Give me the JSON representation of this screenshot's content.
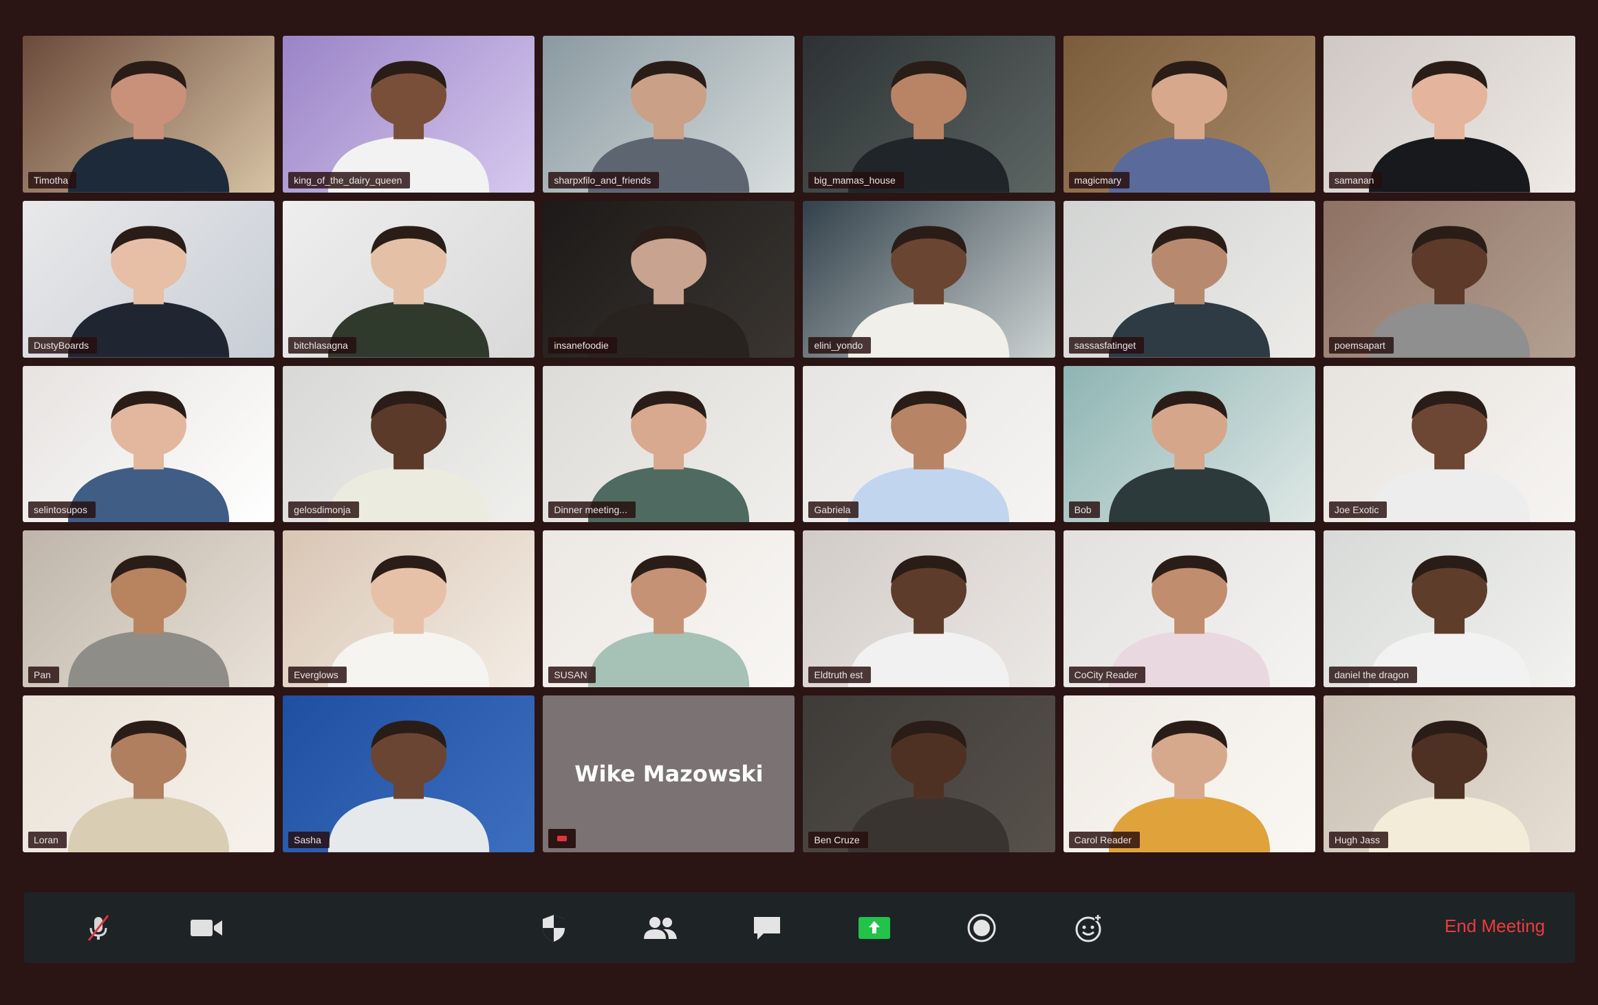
{
  "participants": [
    {
      "name": "Timotha",
      "skin": "#c9907a",
      "bg1": "#6b4a3a",
      "bg2": "#d7c3a5",
      "shirt": "#1d2a3a"
    },
    {
      "name": "king_of_the_dairy_queen",
      "skin": "#7a4f3a",
      "bg1": "#9b84c7",
      "bg2": "#d6c9ef",
      "shirt": "#f2f2f2"
    },
    {
      "name": "sharpxfilo_and_friends",
      "skin": "#caa086",
      "bg1": "#8a9aa1",
      "bg2": "#d9dede",
      "shirt": "#5c6570"
    },
    {
      "name": "big_mamas_house",
      "skin": "#b98466",
      "bg1": "#2c3233",
      "bg2": "#5e6664",
      "shirt": "#1f2528"
    },
    {
      "name": "magicmary",
      "skin": "#d8a88d",
      "bg1": "#7b5c3b",
      "bg2": "#a88b6b",
      "shirt": "#5a6a9a"
    },
    {
      "name": "samanan",
      "skin": "#e4b49c",
      "bg1": "#cfc8c4",
      "bg2": "#efeae6",
      "shirt": "#17191c"
    },
    {
      "name": "DustyBoards",
      "skin": "#e6bfa6",
      "bg1": "#e9e9ea",
      "bg2": "#c8ced6",
      "shirt": "#1f2632"
    },
    {
      "name": "bitchlasagna",
      "skin": "#e4c0a6",
      "bg1": "#eeeeee",
      "bg2": "#d9d9d9",
      "shirt": "#2f3a2c"
    },
    {
      "name": "insanefoodie",
      "skin": "#c7a390",
      "bg1": "#1c1a18",
      "bg2": "#3a3531",
      "shirt": "#28231f"
    },
    {
      "name": "elini_yondo",
      "skin": "#6a4532",
      "bg1": "#32414a",
      "bg2": "#cdd3d3",
      "shirt": "#f1efe9"
    },
    {
      "name": "sassasfatinget",
      "skin": "#b78a70",
      "bg1": "#d2d4d3",
      "bg2": "#ecebe8",
      "shirt": "#2e3a44"
    },
    {
      "name": "poemsapart",
      "skin": "#5d3a2a",
      "bg1": "#8e7264",
      "bg2": "#b4a091",
      "shirt": "#8f8f8f"
    },
    {
      "name": "selintosupos",
      "skin": "#e3b79e",
      "bg1": "#e6e3e0",
      "bg2": "#ffffff",
      "shirt": "#3f5d85"
    },
    {
      "name": "gelosdimonja",
      "skin": "#5b3a2a",
      "bg1": "#d8d9d6",
      "bg2": "#efefec",
      "shirt": "#ecebdf"
    },
    {
      "name": "Dinner meeting...",
      "skin": "#d8a98e",
      "bg1": "#dedcd8",
      "bg2": "#efeeeb",
      "shirt": "#4f6a60"
    },
    {
      "name": "Gabriela",
      "skin": "#b88466",
      "bg1": "#e7e5e3",
      "bg2": "#f5f4f3",
      "shirt": "#c2d5ef"
    },
    {
      "name": "Bob",
      "skin": "#d6a68a",
      "bg1": "#8db5b3",
      "bg2": "#dfe8e6",
      "shirt": "#2d3a3c"
    },
    {
      "name": "Joe Exotic",
      "skin": "#6e4634",
      "bg1": "#e7e3de",
      "bg2": "#f6f4f1",
      "shirt": "#ededed"
    },
    {
      "name": "Pan",
      "skin": "#b8835f",
      "bg1": "#bfb5aa",
      "bg2": "#e8e1d7",
      "shirt": "#8f8d87"
    },
    {
      "name": "Everglows",
      "skin": "#e7c1a7",
      "bg1": "#d9c6b4",
      "bg2": "#f3ece4",
      "shirt": "#f6f4f0"
    },
    {
      "name": "SUSAN",
      "skin": "#c69275",
      "bg1": "#ece8e4",
      "bg2": "#f8f6f3",
      "shirt": "#a6c2b6"
    },
    {
      "name": "Eldtruth est",
      "skin": "#5e3c2b",
      "bg1": "#d2ccc8",
      "bg2": "#ebe7e4",
      "shirt": "#f1f1f1"
    },
    {
      "name": "CoCity Reader",
      "skin": "#c08d6e",
      "bg1": "#e3e1df",
      "bg2": "#f4f3f2",
      "shirt": "#ead8e0"
    },
    {
      "name": "daniel the dragon",
      "skin": "#5f3d2b",
      "bg1": "#d7dad8",
      "bg2": "#f2f2ef",
      "shirt": "#f2f2f2"
    },
    {
      "name": "Loran",
      "skin": "#b07f5f",
      "bg1": "#e9e2d8",
      "bg2": "#f6f1ea",
      "shirt": "#d9cdb4"
    },
    {
      "name": "Sasha",
      "skin": "#6b4533",
      "bg1": "#1f4fa0",
      "bg2": "#3d6fc1",
      "shirt": "#e5e9ec"
    },
    {
      "name": "Ben Cruze",
      "skin": "#4f3123",
      "bg1": "#3e3b38",
      "bg2": "#57514b",
      "shirt": "#3a3431"
    },
    {
      "name": "Carol Reader",
      "skin": "#d7a98c",
      "bg1": "#efeae4",
      "bg2": "#faf7f3",
      "shirt": "#e0a33b"
    },
    {
      "name": "Hugh Jass",
      "skin": "#4e3123",
      "bg1": "#c9bfb3",
      "bg2": "#e6ded3",
      "shirt": "#f3ecd8"
    }
  ],
  "placeholder": {
    "name": "Wike Mazowski"
  },
  "toolbar": {
    "buttons": [
      {
        "icon": "microphone-muted-icon"
      },
      {
        "icon": "video-camera-icon"
      },
      {
        "icon": "security-shield-icon"
      },
      {
        "icon": "participants-icon"
      },
      {
        "icon": "chat-icon"
      },
      {
        "icon": "share-screen-icon"
      },
      {
        "icon": "record-icon"
      },
      {
        "icon": "reactions-icon"
      }
    ],
    "end_label": "End Meeting"
  },
  "colors": {
    "background": "#2a1414",
    "toolbar": "#1e2326",
    "end": "#ef3b3b",
    "share": "#23c24a"
  }
}
